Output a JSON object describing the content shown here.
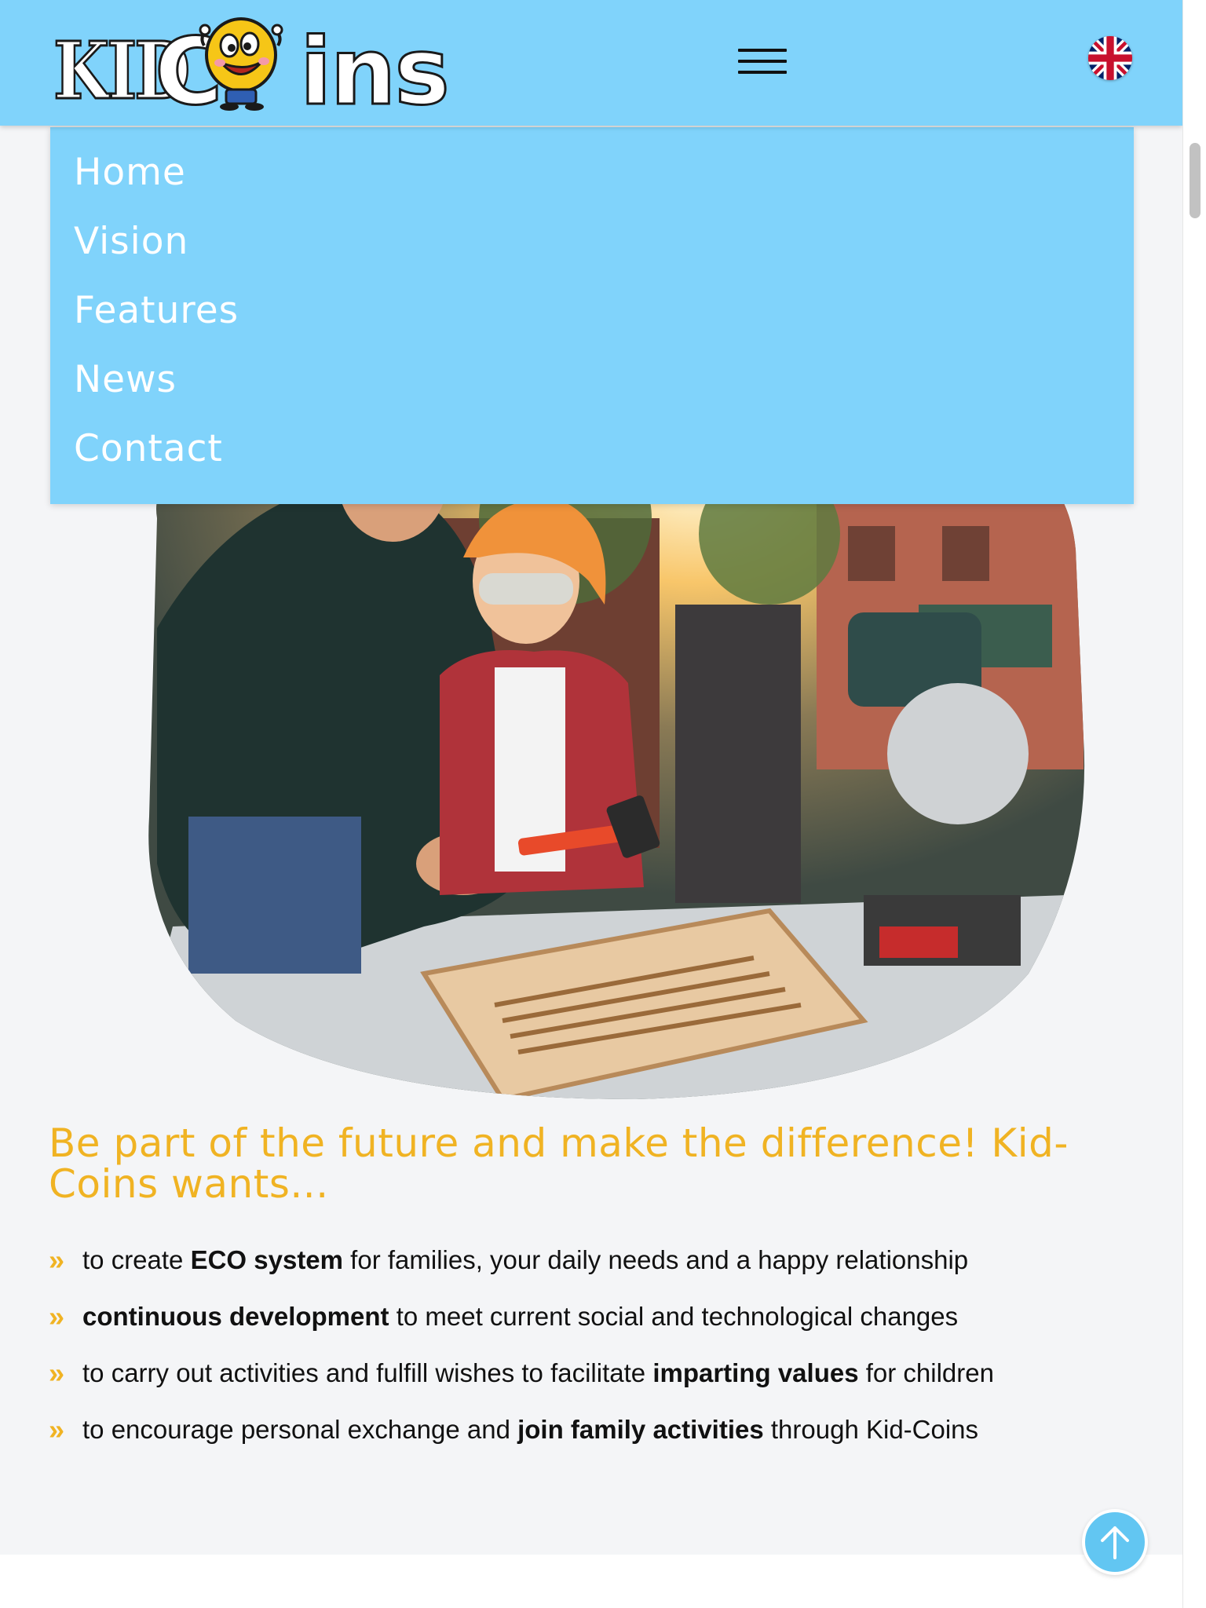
{
  "header": {
    "logo_kid": "KID",
    "logo_c": "C",
    "logo_ins": "ins",
    "logo_alt": "KidCoins",
    "language_flag": "uk-flag-icon",
    "menu_icon": "hamburger-menu-icon"
  },
  "menu": {
    "items": [
      {
        "label": "Home"
      },
      {
        "label": "Vision"
      },
      {
        "label": "Features"
      },
      {
        "label": "News"
      },
      {
        "label": "Contact"
      }
    ]
  },
  "content": {
    "headline": "Be part of the future and make the difference! Kid-Coins wants...",
    "bullets": [
      {
        "before": "to create ",
        "bold": "ECO system",
        "after": " for families, your daily needs and a happy relationship"
      },
      {
        "before": "",
        "bold": "continuous development",
        "after": " to meet current social and technological changes"
      },
      {
        "before": "to carry out activities and fulfill wishes to facilitate ",
        "bold": "imparting values",
        "after": " for children"
      },
      {
        "before": "to encourage personal exchange and ",
        "bold": "join family activities",
        "after": " through Kid-Coins"
      }
    ],
    "bullet_mark": "»"
  },
  "colors": {
    "header_bg": "#80d3fb",
    "accent_yellow": "#f0b323",
    "scroll_button": "#62c6f2"
  }
}
